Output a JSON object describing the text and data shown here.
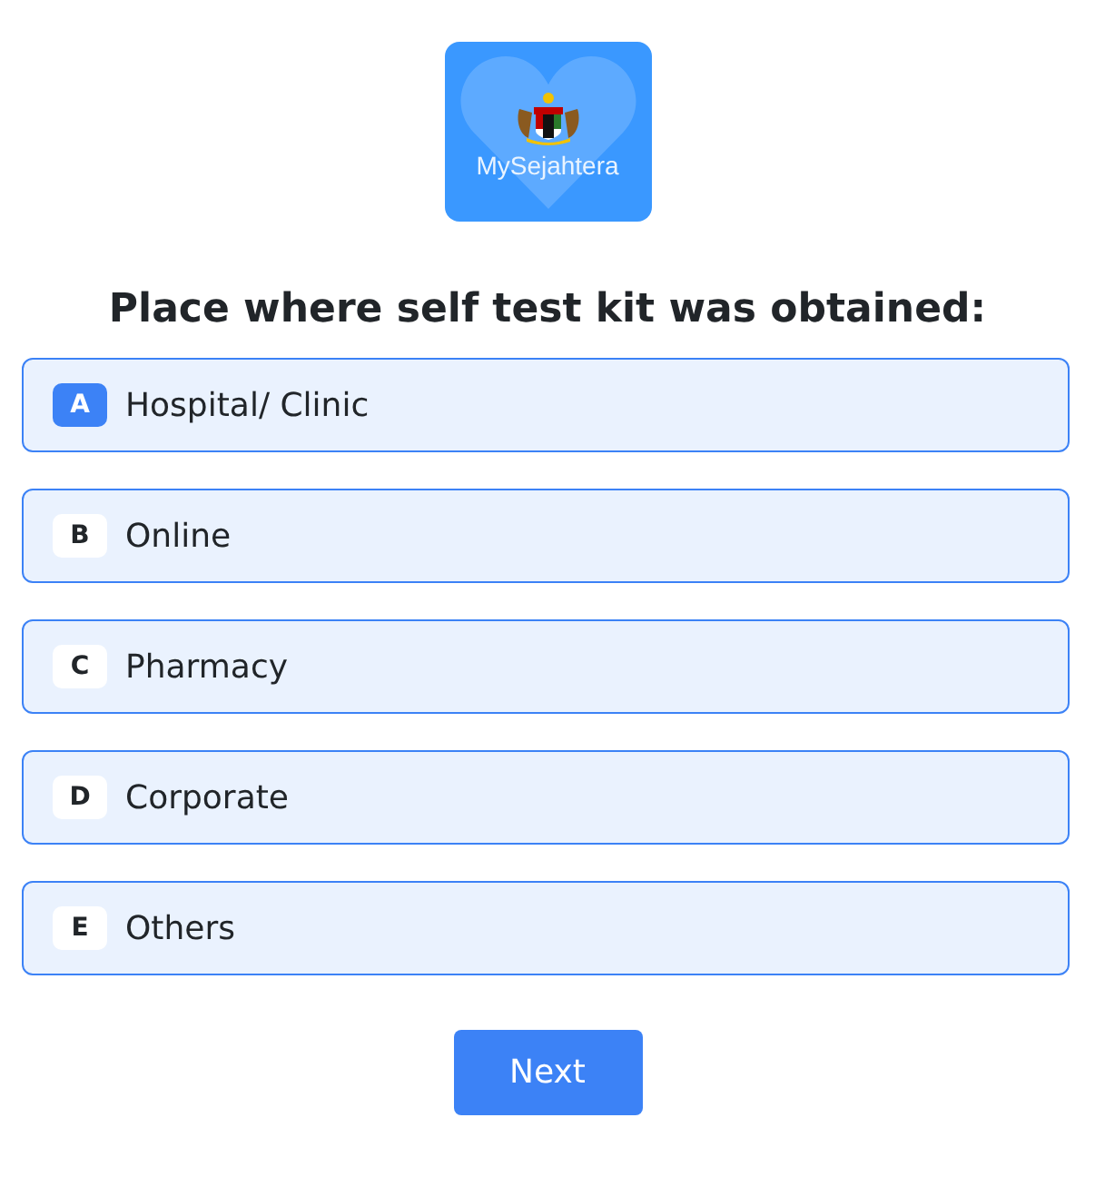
{
  "logo": {
    "text": "MySejahtera"
  },
  "question": "Place where self test kit was obtained:",
  "options": [
    {
      "letter": "A",
      "label": "Hospital/ Clinic",
      "selected": true
    },
    {
      "letter": "B",
      "label": "Online",
      "selected": false
    },
    {
      "letter": "C",
      "label": "Pharmacy",
      "selected": false
    },
    {
      "letter": "D",
      "label": "Corporate",
      "selected": false
    },
    {
      "letter": "E",
      "label": "Others",
      "selected": false
    }
  ],
  "next_button": "Next"
}
